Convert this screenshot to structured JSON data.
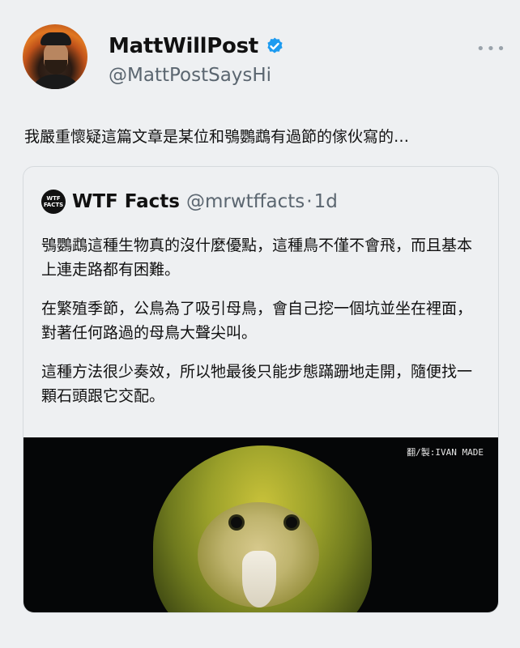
{
  "tweet": {
    "author_name": "MattWillPost",
    "author_handle": "@MattPostSaysHi",
    "text": "我嚴重懷疑這篇文章是某位和鴞鸚鵡有過節的傢伙寫的…",
    "more_label": "•••"
  },
  "quoted": {
    "logo_top": "WTF",
    "logo_bottom": "FACTS",
    "name": "WTF Facts",
    "handle": "@mrwtffacts",
    "separator": "·",
    "time": "1d",
    "paragraphs": [
      "鴞鸚鵡這種生物真的沒什麼優點，這種鳥不僅不會飛，而且基本上連走路都有困難。",
      "在繁殖季節，公鳥為了吸引母鳥，會自己挖一個坑並坐在裡面，對著任何路過的母鳥大聲尖叫。",
      "這種方法很少奏效，所以牠最後只能步態蹣跚地走開，隨便找一顆石頭跟它交配。"
    ],
    "image_credit": "翻/製:IVAN MADE"
  },
  "colors": {
    "verified": "#1d9bf0",
    "background": "#eef0f2",
    "secondary_text": "#5b6670"
  }
}
